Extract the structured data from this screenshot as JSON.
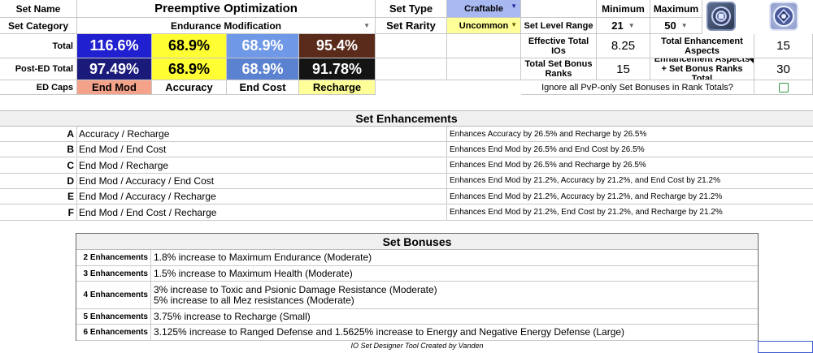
{
  "header": {
    "set_name_label": "Set Name",
    "set_name": "Preemptive Optimization",
    "set_type_label": "Set Type",
    "set_type": "Craftable",
    "minimum_label": "Minimum",
    "maximum_label": "Maximum",
    "set_category_label": "Set Category",
    "set_category": "Endurance Modification",
    "set_rarity_label": "Set Rarity",
    "set_rarity": "Uncommon",
    "set_level_range_label": "Set Level Range",
    "level_min": "21",
    "level_max": "50"
  },
  "totals": {
    "total_label": "Total",
    "post_ed_label": "Post-ED Total",
    "ed_caps_label": "ED Caps",
    "total_values": [
      "116.6%",
      "68.9%",
      "68.9%",
      "95.4%"
    ],
    "post_ed_values": [
      "97.49%",
      "68.9%",
      "68.9%",
      "91.78%"
    ],
    "caps": [
      "End Mod",
      "Accuracy",
      "End Cost",
      "Recharge"
    ],
    "colors": {
      "total_bg": [
        "#2020d0",
        "#ffff33",
        "#6f98e6",
        "#5a2a1a"
      ],
      "post_ed_bg": [
        "#1a1a7a",
        "#ffff33",
        "#5b82d0",
        "#141414"
      ],
      "caps_bg": [
        "#f4a28a",
        "#ffffff",
        "#ffffff",
        "#ffff99"
      ]
    }
  },
  "stats": {
    "effective_ios_label": "Effective Total IOs",
    "effective_ios": "8.25",
    "total_enh_aspects_label": "Total Enhancement Aspects",
    "total_enh_aspects": "15",
    "total_set_bonus_ranks_label": "Total Set Bonus Ranks",
    "total_set_bonus_ranks": "15",
    "enh_plus_bonus_label": "Enhancement Aspects + Set Bonus Ranks Total",
    "enh_plus_bonus": "30",
    "ignore_pvp_label": "Ignore all PvP-only Set Bonuses in Rank Totals?",
    "ignore_pvp_checked": false
  },
  "enhancements": {
    "title": "Set Enhancements",
    "rows": [
      {
        "letter": "A",
        "name": "Accuracy / Recharge",
        "desc": "Enhances Accuracy by 26.5% and Recharge by 26.5%"
      },
      {
        "letter": "B",
        "name": "End Mod / End Cost",
        "desc": "Enhances End Mod by 26.5% and End Cost by 26.5%"
      },
      {
        "letter": "C",
        "name": "End Mod / Recharge",
        "desc": "Enhances End Mod by 26.5% and Recharge by 26.5%"
      },
      {
        "letter": "D",
        "name": "End Mod / Accuracy / End Cost",
        "desc": "Enhances End Mod by 21.2%, Accuracy by 21.2%, and End Cost by 21.2%"
      },
      {
        "letter": "E",
        "name": "End Mod / Accuracy / Recharge",
        "desc": "Enhances End Mod by 21.2%, Accuracy by 21.2%, and Recharge by 21.2%"
      },
      {
        "letter": "F",
        "name": "End Mod / End Cost / Recharge",
        "desc": "Enhances End Mod by 21.2%, End Cost by 21.2%, and Recharge by 21.2%"
      }
    ]
  },
  "bonuses": {
    "title": "Set Bonuses",
    "rows": [
      {
        "label": "2 Enhancements",
        "lines": [
          "1.8% increase to Maximum Endurance (Moderate)"
        ]
      },
      {
        "label": "3 Enhancements",
        "lines": [
          "1.5% increase to Maximum Health (Moderate)"
        ]
      },
      {
        "label": "4 Enhancements",
        "lines": [
          "3% increase to Toxic and Psionic Damage Resistance (Moderate)",
          "5% increase to all Mez resistances (Moderate)"
        ]
      },
      {
        "label": "5 Enhancements",
        "lines": [
          "3.75% increase to Recharge (Small)"
        ]
      },
      {
        "label": "6 Enhancements",
        "lines": [
          "3.125% increase to Ranged Defense and 1.5625% increase to Energy and Negative Energy Defense (Large)"
        ]
      }
    ]
  },
  "footer": {
    "credit": "IO Set Designer Tool Created by Vanden"
  },
  "icons": [
    "enhancement-icon",
    "attuned-enhancement-icon"
  ]
}
